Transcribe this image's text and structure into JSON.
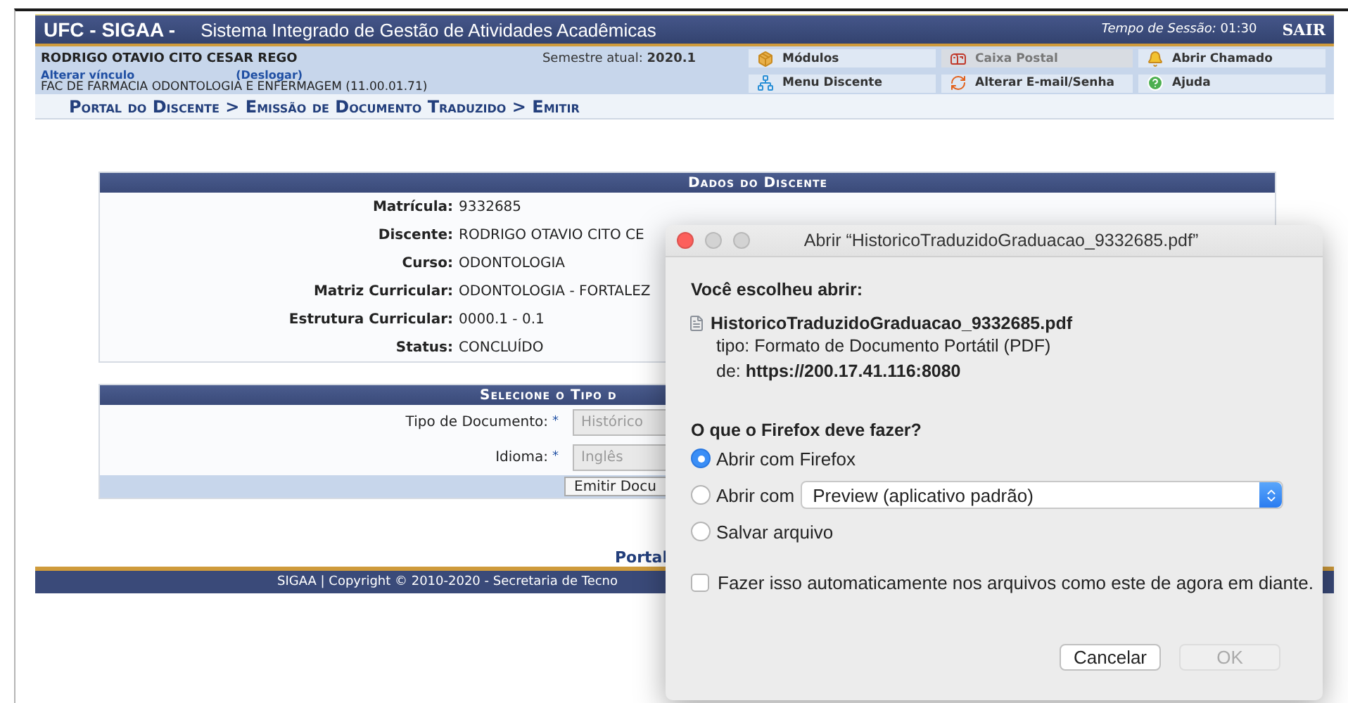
{
  "header": {
    "logo": "UFC - SIGAA -",
    "system_name": "Sistema Integrado de Gestão de Atividades Acadêmicas",
    "session_label": "Tempo de Sessão:",
    "session_time": "01:30",
    "logout": "SAIR"
  },
  "user": {
    "name": "RODRIGO OTAVIO CITO CESAR REGO",
    "change_link": "Alterar vínculo",
    "logout_link": "(Deslogar)",
    "unit": "FAC DE FARMACIA ODONTOLOGIA E ENFERMAGEM (11.00.01.71)",
    "semester_label": "Semestre atual:",
    "semester": "2020.1"
  },
  "menu": [
    {
      "kind": "modules",
      "label": "Módulos",
      "disabled": false
    },
    {
      "kind": "mailbox",
      "label": "Caixa Postal",
      "disabled": true
    },
    {
      "kind": "bell",
      "label": "Abrir Chamado",
      "disabled": false
    },
    {
      "kind": "tree",
      "label": "Menu Discente",
      "disabled": false
    },
    {
      "kind": "refresh",
      "label": "Alterar E-mail/Senha",
      "disabled": false
    },
    {
      "kind": "help",
      "label": "Ajuda",
      "disabled": false
    }
  ],
  "breadcrumb": "Portal do Discente > Emissão de Documento Traduzido > Emitir",
  "student_card": {
    "title": "Dados do Discente",
    "fields": [
      {
        "label": "Matrícula:",
        "value": "9332685"
      },
      {
        "label": "Discente:",
        "value": "RODRIGO OTAVIO CITO CE"
      },
      {
        "label": "Curso:",
        "value": "ODONTOLOGIA"
      },
      {
        "label": "Matriz Curricular:",
        "value": "ODONTOLOGIA - FORTALEZ"
      },
      {
        "label": "Estrutura Curricular:",
        "value": "0000.1 - 0.1"
      },
      {
        "label": "Status:",
        "value": "CONCLUÍDO"
      }
    ]
  },
  "document_form": {
    "title": "Selecione o Tipo d",
    "fields": [
      {
        "label": "Tipo de Documento:",
        "required_mark": "*",
        "value": "Histórico",
        "disabled": true
      },
      {
        "label": "Idioma:",
        "required_mark": "*",
        "value": "Inglês",
        "disabled": true
      }
    ],
    "submit": "Emitir Docu"
  },
  "portal_link": "Portal",
  "footer": "SIGAA | Copyright © 2010-2020 - Secretaria de Tecno",
  "dialog": {
    "title": "Abrir “HistoricoTraduzidoGraduacao_9332685.pdf”",
    "intro": "Você escolheu abrir:",
    "file_name": "HistoricoTraduzidoGraduacao_9332685.pdf",
    "type_label": "tipo:",
    "type_value": "Formato de Documento Portátil (PDF)",
    "from_label": "de:",
    "from_value": "https://200.17.41.116:8080",
    "question": "O que o Firefox deve fazer?",
    "options": [
      {
        "kind": "plain",
        "label": "Abrir com Firefox",
        "selected": true
      },
      {
        "kind": "app",
        "label": "Abrir com",
        "app": "Preview (aplicativo padrão)",
        "selected": false
      },
      {
        "kind": "plain",
        "label": "Salvar arquivo",
        "selected": false
      }
    ],
    "remember": {
      "label": "Fazer isso automaticamente nos arquivos como este de agora em diante.",
      "checked": false
    },
    "buttons": [
      {
        "label": "Cancelar",
        "disabled": false
      },
      {
        "label": "OK",
        "disabled": true
      }
    ]
  }
}
